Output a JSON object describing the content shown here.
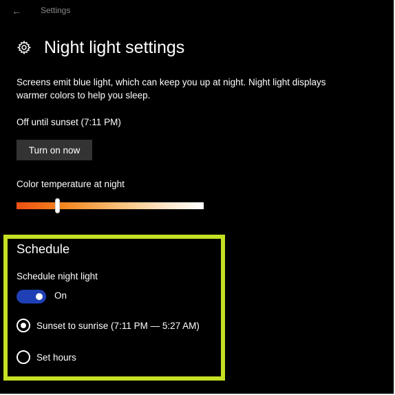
{
  "titlebar": {
    "back_icon": "back-arrow-icon",
    "title": "Settings"
  },
  "header": {
    "icon": "gear-icon",
    "title": "Night light settings"
  },
  "description": "Screens emit blue light, which can keep you up at night. Night light displays warmer colors to help you sleep.",
  "status": {
    "text": "Off until sunset (7:11 PM)",
    "button_label": "Turn on now"
  },
  "color_temperature": {
    "label": "Color temperature at night",
    "level": 0.22,
    "gradient_colors": [
      "#ee4f13",
      "#f3861f",
      "#f8c07a",
      "#fde6cb",
      "#ffffff"
    ]
  },
  "schedule": {
    "title": "Schedule",
    "toggle_label": "Schedule night light",
    "toggle_state": "On",
    "toggle_on": true,
    "options": [
      {
        "label": "Sunset to sunrise (7:11 PM — 5:27 AM)",
        "selected": true
      },
      {
        "label": "Set hours",
        "selected": false
      }
    ]
  },
  "colors": {
    "background": "#000000",
    "accent": "#1f3fb5",
    "highlight_border": "#c5e022",
    "button_bg": "#333333",
    "muted_text": "#8a8a8a"
  }
}
